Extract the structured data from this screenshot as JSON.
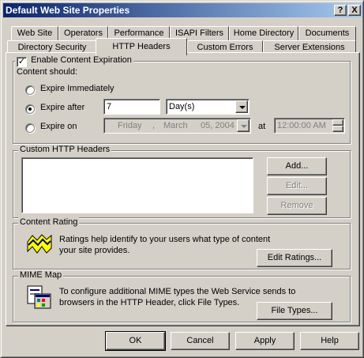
{
  "window": {
    "title": "Default Web Site Properties",
    "help_button": "?",
    "close_button": "X"
  },
  "tabs_row1": [
    "Web Site",
    "Operators",
    "Performance",
    "ISAPI Filters",
    "Home Directory",
    "Documents"
  ],
  "tabs_row2": [
    "Directory Security",
    "HTTP Headers",
    "Custom Errors",
    "Server Extensions"
  ],
  "selected_tab": "HTTP Headers",
  "expiration": {
    "enable_label": "Enable Content Expiration",
    "enabled": true,
    "content_should_label": "Content should:",
    "option_immediately": "Expire Immediately",
    "option_after": "Expire after",
    "option_on": "Expire on",
    "selected_option": "after",
    "after_value": "7",
    "after_unit": "Day(s)",
    "on_date_weekday": "Friday",
    "on_date_sep": ",",
    "on_date_month": "March",
    "on_date_rest": "05, 2004",
    "at_label": "at",
    "on_time": "12:00:00 AM"
  },
  "custom_headers": {
    "title": "Custom HTTP Headers",
    "add": "Add...",
    "edit": "Edit...",
    "remove": "Remove"
  },
  "content_rating": {
    "title": "Content Rating",
    "text": "Ratings help identify to your users what type of content your site provides.",
    "edit_ratings": "Edit Ratings..."
  },
  "mime_map": {
    "title": "MIME Map",
    "text": "To configure additional MIME types the Web Service sends to browsers in the HTTP Header, click File Types.",
    "file_types": "File Types..."
  },
  "footer": {
    "ok": "OK",
    "cancel": "Cancel",
    "apply": "Apply",
    "help": "Help"
  }
}
